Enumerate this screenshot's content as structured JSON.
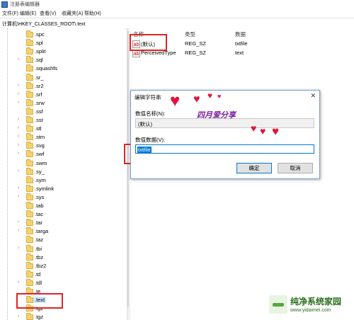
{
  "window": {
    "title": "注册表编辑器"
  },
  "menu": [
    "文件(F)",
    "编辑(E)",
    "查看(V)",
    "收藏夹(A)",
    "帮助(H)"
  ],
  "address": "计算机\\HKEY_CLASSES_ROOT\\.text",
  "tree": {
    "items": [
      {
        "label": ".spc",
        "has_children": false
      },
      {
        "label": ".spl",
        "has_children": false
      },
      {
        "label": ".split",
        "has_children": false
      },
      {
        "label": ".sql",
        "has_children": true
      },
      {
        "label": ".squashfs",
        "has_children": false
      },
      {
        "label": ".sr_",
        "has_children": false
      },
      {
        "label": ".sr2",
        "has_children": true
      },
      {
        "label": ".srf",
        "has_children": true
      },
      {
        "label": ".srw",
        "has_children": true
      },
      {
        "label": ".ssf",
        "has_children": false
      },
      {
        "label": ".sst",
        "has_children": true
      },
      {
        "label": ".stl",
        "has_children": true
      },
      {
        "label": ".stm",
        "has_children": true
      },
      {
        "label": ".svg",
        "has_children": true
      },
      {
        "label": ".swf",
        "has_children": true
      },
      {
        "label": ".swm",
        "has_children": false
      },
      {
        "label": ".sy_",
        "has_children": true
      },
      {
        "label": ".sym",
        "has_children": false
      },
      {
        "label": ".symlink",
        "has_children": true
      },
      {
        "label": ".sys",
        "has_children": true
      },
      {
        "label": ".tab",
        "has_children": false
      },
      {
        "label": ".tac",
        "has_children": false
      },
      {
        "label": ".tar",
        "has_children": true
      },
      {
        "label": ".targa",
        "has_children": true
      },
      {
        "label": ".taz",
        "has_children": false
      },
      {
        "label": ".tbi",
        "has_children": true
      },
      {
        "label": ".tbz",
        "has_children": false
      },
      {
        "label": ".tbz2",
        "has_children": false
      },
      {
        "label": ".td",
        "has_children": false
      },
      {
        "label": ".tdl",
        "has_children": true
      },
      {
        "label": ".te",
        "has_children": false
      },
      {
        "label": ".text",
        "has_children": false,
        "selected": true
      },
      {
        "label": ".tgz",
        "has_children": false
      },
      {
        "label": ".tgz",
        "has_children": true
      }
    ]
  },
  "values": {
    "headers": {
      "name": "名称",
      "type": "类型",
      "data": "数据"
    },
    "rows": [
      {
        "name": "(默认)",
        "type": "REG_SZ",
        "data": "txtfile"
      },
      {
        "name": "PerceivedType",
        "type": "REG_SZ",
        "data": "text"
      }
    ]
  },
  "dialog": {
    "title": "编辑字符串",
    "name_label": "数值名称(N):",
    "name_value": "(默认)",
    "data_label": "数值数据(V):",
    "data_value": "txtfile",
    "ok_label": "确定",
    "cancel_label": "取消"
  },
  "overlay_text": "四月爱分享",
  "watermark": {
    "name": "纯净系统家园",
    "url": "www.yidaimei.com"
  },
  "colors": {
    "accent": "#0078d7",
    "highlight_box": "#e02424",
    "selection": "#cce8ff"
  }
}
